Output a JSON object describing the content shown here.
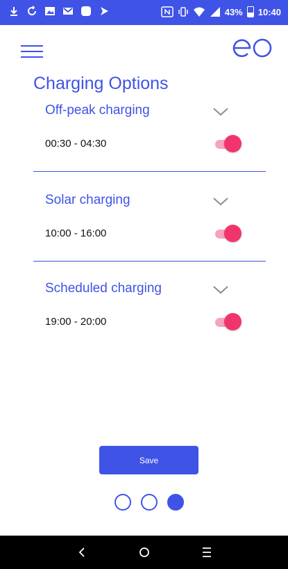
{
  "status_bar": {
    "battery_text": "43%",
    "time": "10:40",
    "icons": [
      "download-icon",
      "sync-icon",
      "gallery-icon",
      "gmail-icon",
      "app-icon",
      "play-icon",
      "nfc-icon",
      "vibrate-icon",
      "wifi-icon",
      "signal-icon",
      "battery-icon"
    ]
  },
  "header": {
    "menu_icon": "hamburger-icon",
    "logo_text": "eo"
  },
  "page": {
    "title": "Charging Options"
  },
  "options": [
    {
      "title": "Off-peak charging",
      "time": "00:30 - 04:30",
      "enabled": true
    },
    {
      "title": "Solar charging",
      "time": "10:00 - 16:00",
      "enabled": true
    },
    {
      "title": "Scheduled charging",
      "time": "19:00 - 20:00",
      "enabled": true
    }
  ],
  "actions": {
    "save_label": "Save"
  },
  "pager": {
    "current_page": 3,
    "total_pages": 3
  },
  "nav_bar": {
    "icons": [
      "back-icon",
      "home-icon",
      "menu-icon"
    ]
  },
  "colors": {
    "accent": "#3f53e6",
    "toggle_on": "#f2346c",
    "toggle_track": "#f6a3c3"
  }
}
